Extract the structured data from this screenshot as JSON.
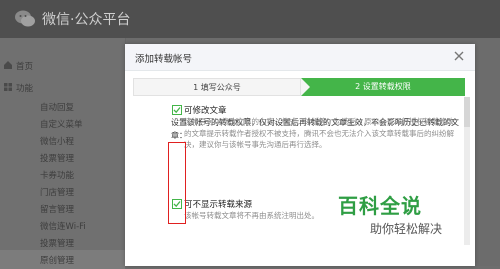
{
  "app": {
    "brand": "微信·公众平台"
  },
  "sidebar": {
    "items": [
      {
        "label": "首页",
        "icon": "home-icon"
      },
      {
        "label": "功能",
        "icon": "function-icon"
      },
      {
        "label": "自动回复"
      },
      {
        "label": "自定义菜单"
      },
      {
        "label": "微信小程"
      },
      {
        "label": "投票管理"
      },
      {
        "label": "卡券功能"
      },
      {
        "label": "门店管理"
      },
      {
        "label": "留言管理"
      },
      {
        "label": "微信连Wi-Fi"
      },
      {
        "label": "投票管理"
      },
      {
        "label": "原创管理"
      }
    ]
  },
  "modal": {
    "title": "添加转载帐号",
    "steps": [
      {
        "label": "1 填写公众号",
        "active": false
      },
      {
        "label": "2 设置转载权限",
        "active": true
      }
    ],
    "description": "设置该帐号的转载权限，仅对设置后再转载的文章生效，不会影响历史已转载的文章：",
    "options": [
      {
        "label": "可修改文章",
        "checked": true,
        "description": "该帐号可以修改文章的内容、格式、排版等，勾选后，原公众号再行授权转载修改的文章提示转载作者授权不被支持，腾讯不会也无法介入该文章转载事后的纠纷解决，建议你与该帐号事先沟通后再行选择。"
      },
      {
        "label": "可不显示转载来源",
        "checked": true,
        "description": "该帐号转载文章将不再由系统注明出处。"
      }
    ]
  },
  "watermark": {
    "title": "百科全说",
    "subtitle": "助你轻松解决"
  },
  "colors": {
    "accent": "#44b549",
    "highlight": "#e02020",
    "watermark": "#2f9e44"
  }
}
